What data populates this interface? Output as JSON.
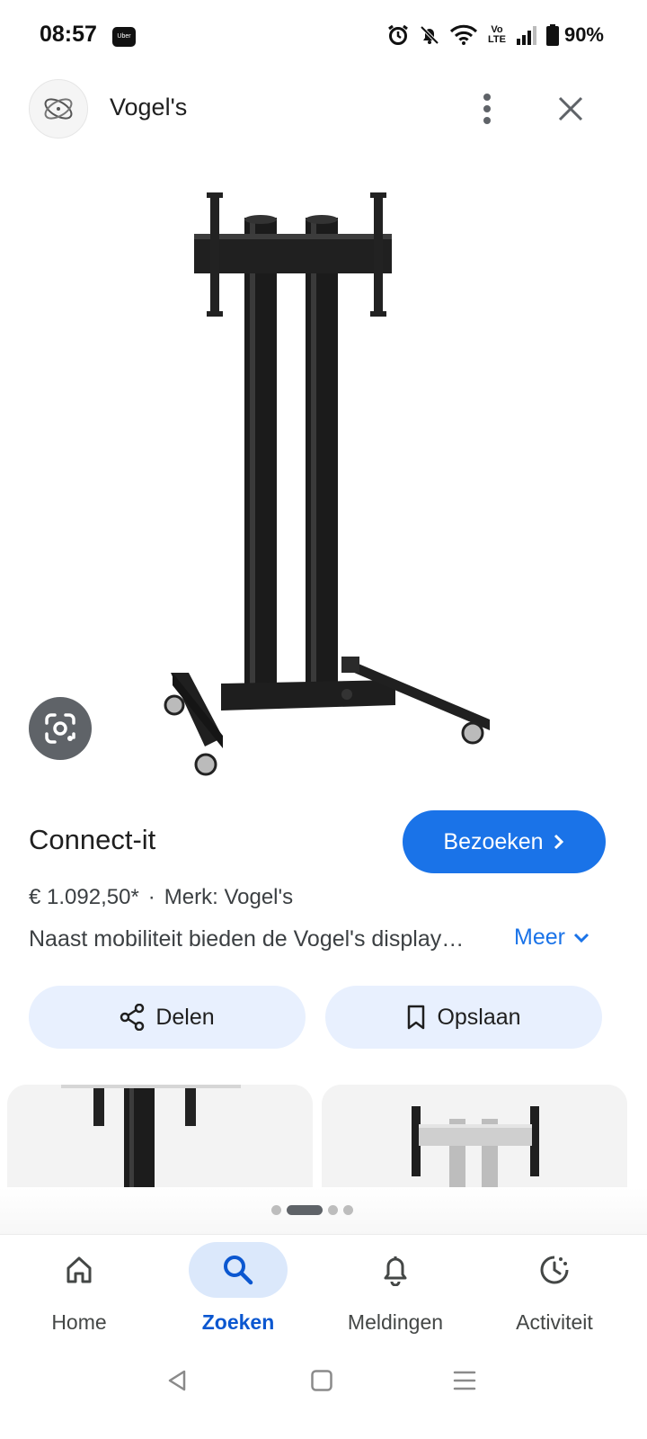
{
  "status_bar": {
    "time": "08:57",
    "uber_badge": "Uber",
    "volte": "Vo LTE",
    "battery": "90%",
    "icons": [
      "alarm-icon",
      "bell-off-icon",
      "wifi-icon",
      "volte-icon",
      "signal-icon",
      "battery-icon"
    ]
  },
  "header": {
    "brand": "Vogel's",
    "logo": "vogels-logo",
    "more_icon": "more-vert-icon",
    "close_icon": "close-icon"
  },
  "product": {
    "image": "tv-floor-stand-black",
    "title": "Connect-it",
    "visit_label": "Bezoeken",
    "price": "€ 1.092,50*",
    "separator": "·",
    "brand_line": "Merk: Vogel's",
    "description": "Naast mobiliteit bieden de Vogel's display…",
    "more_label": "Meer"
  },
  "actions": {
    "share_label": "Delen",
    "save_label": "Opslaan"
  },
  "related": {
    "items": [
      "tv-stand-closeup-black",
      "tv-stand-silver"
    ],
    "page_count": 4,
    "active_page": 2
  },
  "bottom_nav": {
    "items": [
      {
        "label": "Home",
        "icon": "home-icon"
      },
      {
        "label": "Zoeken",
        "icon": "search-icon",
        "active": true
      },
      {
        "label": "Meldingen",
        "icon": "bell-icon"
      },
      {
        "label": "Activiteit",
        "icon": "activity-icon"
      }
    ]
  },
  "colors": {
    "accent": "#1a73e8",
    "chip_bg": "#e8f0fe",
    "active_nav_bg": "#dbe8fb",
    "active_nav_text": "#0b57d0"
  }
}
